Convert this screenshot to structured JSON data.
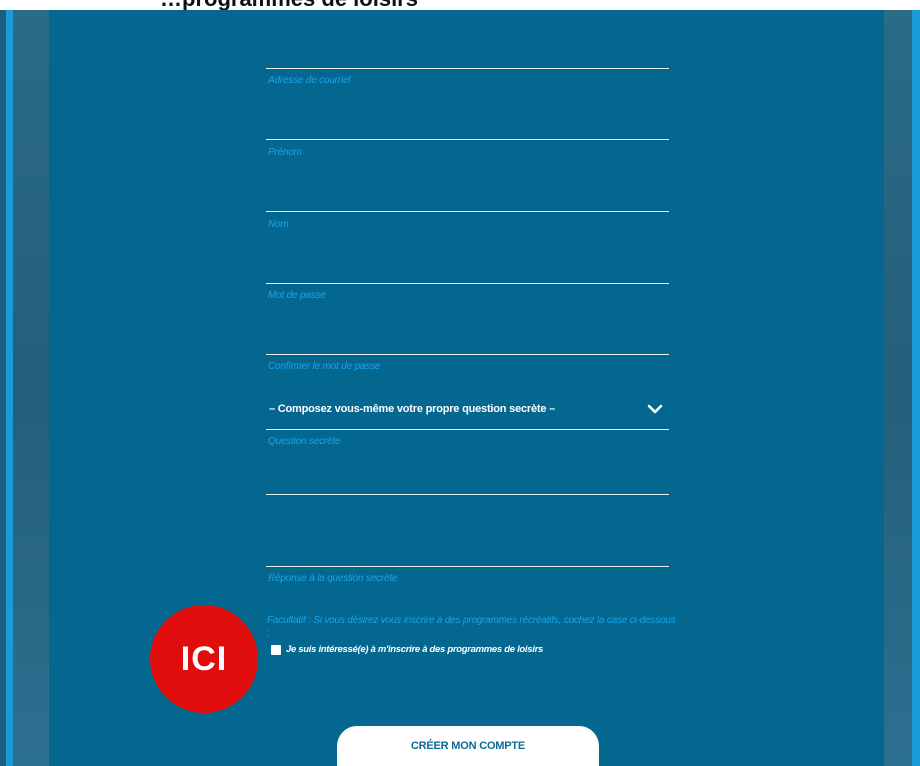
{
  "header": {
    "partial_text": "…programmes de loisirs"
  },
  "form": {
    "fields": [
      {
        "label": "Adresse de courriel"
      },
      {
        "label": "Prénom"
      },
      {
        "label": "Nom"
      },
      {
        "label": "Mot de passe"
      },
      {
        "label": "Confirmer le mot de passe"
      }
    ],
    "secret_question_select": {
      "value": "– Composez vous-même votre propre question secrète –",
      "icon": "chevron-down-icon"
    },
    "secret_question_label": "Question secrète",
    "secret_answer_label": "Réponse à la question secrète",
    "optional_text": "Facultatif : Si vous désirez vous inscrire à des programmes récréatifs, cochez la case ci-dessous :",
    "checkbox_label": "Je suis intéressé(e) à m'inscrire à des programmes de loisirs",
    "checkbox_checked": false,
    "submit_label": "CRÉER MON COMPTE"
  },
  "annotation": {
    "badge_text": "ICI",
    "badge_color": "#e10d0d"
  },
  "colors": {
    "panel": "#046790",
    "label": "#1aa3e8",
    "accent": "#1a9ad6",
    "button_text": "#0b6a94"
  }
}
